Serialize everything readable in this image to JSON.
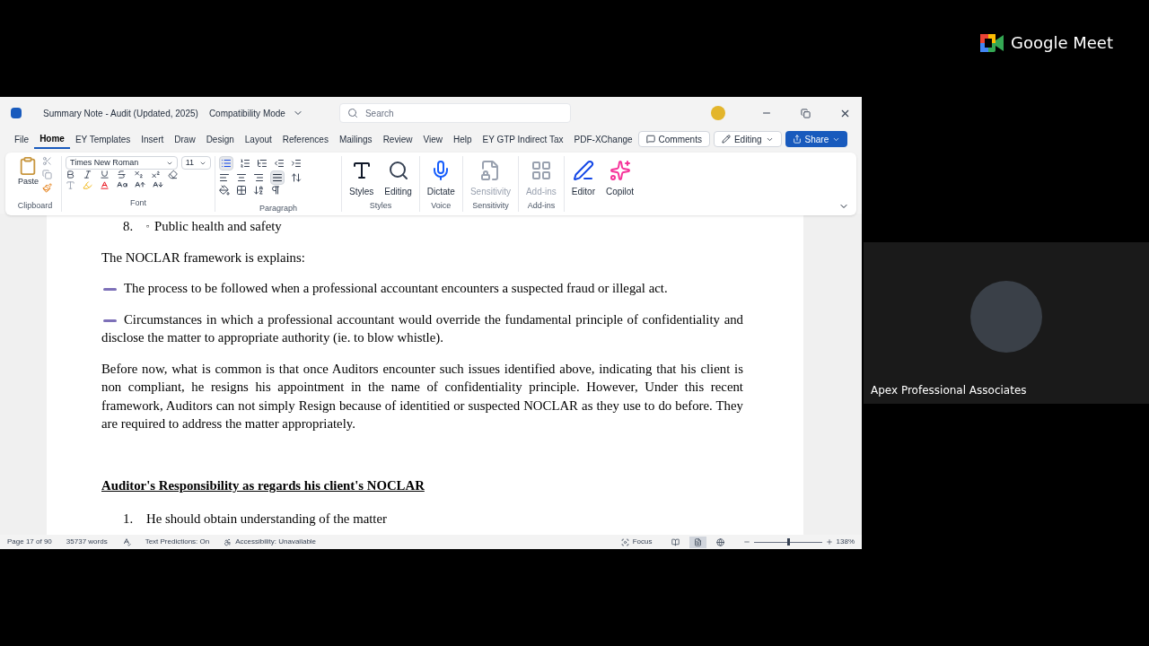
{
  "window": {
    "title": "Summary Note - Audit (Updated, 2025)",
    "mode": "Compatibility Mode",
    "search_placeholder": "Search"
  },
  "menu_tabs": [
    {
      "label": "File",
      "selected": false
    },
    {
      "label": "Home",
      "selected": true
    },
    {
      "label": "EY Templates",
      "selected": false
    },
    {
      "label": "Insert",
      "selected": false
    },
    {
      "label": "Draw",
      "selected": false
    },
    {
      "label": "Design",
      "selected": false
    },
    {
      "label": "Layout",
      "selected": false
    },
    {
      "label": "References",
      "selected": false
    },
    {
      "label": "Mailings",
      "selected": false
    },
    {
      "label": "Review",
      "selected": false
    },
    {
      "label": "View",
      "selected": false
    },
    {
      "label": "Help",
      "selected": false
    },
    {
      "label": "EY GTP Indirect Tax",
      "selected": false
    },
    {
      "label": "PDF-XChange",
      "selected": false
    }
  ],
  "header_buttons": {
    "comments": "Comments",
    "editing": "Editing",
    "share": "Share"
  },
  "ribbon": {
    "font_name": "Times New Roman",
    "font_size": "11",
    "bullets_on": true,
    "justify_on": true,
    "paste": "Paste",
    "group_labels": [
      "Clipboard",
      "Font",
      "Paragraph",
      "Styles",
      "Voice",
      "Sensitivity",
      "Add-ins"
    ],
    "big_buttons": [
      {
        "kind": "styles",
        "label": "Styles",
        "disabled": false
      },
      {
        "kind": "editing",
        "label": "Editing",
        "disabled": false
      },
      {
        "kind": "dictate",
        "label": "Dictate",
        "disabled": false
      },
      {
        "kind": "sensitivity",
        "label": "Sensitivity",
        "disabled": true
      },
      {
        "kind": "addins",
        "label": "Add-ins",
        "disabled": true
      },
      {
        "kind": "editor",
        "label": "Editor",
        "disabled": false
      },
      {
        "kind": "copilot",
        "label": "Copilot",
        "disabled": false
      }
    ]
  },
  "document": [
    {
      "kind": "numbered",
      "number": "8.",
      "marker": "▫",
      "text": "Public health and safety"
    },
    {
      "kind": "para",
      "text": "The NOCLAR framework is explains:"
    },
    {
      "kind": "bullet",
      "text": "The process to be followed when a professional accountant encounters a suspected fraud or illegal act."
    },
    {
      "kind": "bullet",
      "text": "Circumstances in which a professional accountant would override the fundamental principle of confidentiality and disclose the matter to appropriate authority (ie. to blow whistle)."
    },
    {
      "kind": "para",
      "text": "Before now, what is common is that once Auditors encounter such issues identified above, indicating that his client is non compliant, he resigns his appointment in the name of confidentiality principle. However, Under this recent framework, Auditors can not simply Resign because of identitied or suspected NOCLAR as they use to do before. They are required to address the matter appropriately."
    },
    {
      "kind": "heading",
      "text": "Auditor's Responsibility as regards his client's NOCLAR"
    },
    {
      "kind": "numbered",
      "number": "1.",
      "text": "He should obtain understanding of the matter"
    }
  ],
  "status_bar": {
    "page": "Page 17 of 90",
    "words": "35737 words",
    "predictions": "Text Predictions: On",
    "accessibility": "Accessibility: Unavailable",
    "focus": "Focus",
    "views": [
      {
        "kind": "read",
        "selected": false
      },
      {
        "kind": "print",
        "selected": true
      },
      {
        "kind": "web",
        "selected": false
      }
    ],
    "zoom": {
      "level": 0.5,
      "reading": "138%"
    }
  },
  "meet": {
    "brand": "Google Meet",
    "participant": "Apex Professional Associates"
  }
}
